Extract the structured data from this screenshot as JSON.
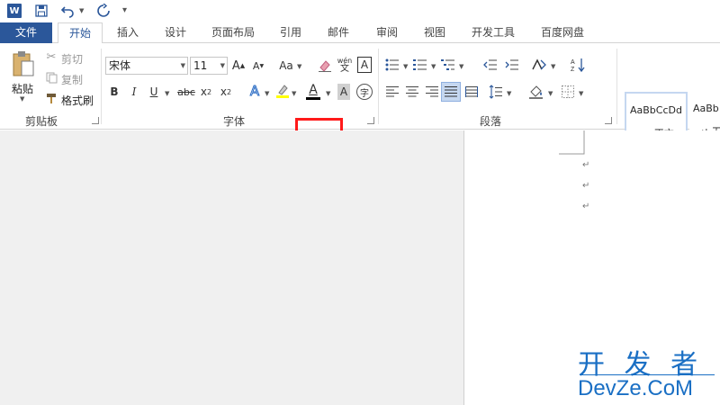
{
  "titlebar": {
    "app_icon": "word-icon",
    "save_icon": "save-icon",
    "undo_icon": "undo-icon",
    "redo_icon": "redo-icon",
    "qat_more": "▾"
  },
  "tabs": [
    {
      "label": "文件"
    },
    {
      "label": "开始"
    },
    {
      "label": "插入"
    },
    {
      "label": "设计"
    },
    {
      "label": "页面布局"
    },
    {
      "label": "引用"
    },
    {
      "label": "邮件"
    },
    {
      "label": "审阅"
    },
    {
      "label": "视图"
    },
    {
      "label": "开发工具"
    },
    {
      "label": "百度网盘"
    }
  ],
  "clipboard": {
    "group_label": "剪贴板",
    "paste_label": "粘贴",
    "cut_label": "剪切",
    "copy_label": "复制",
    "format_painter_label": "格式刷"
  },
  "font": {
    "group_label": "字体",
    "font_name": "宋体",
    "font_size": "11",
    "change_case": "Aa",
    "bold": "B",
    "italic": "I",
    "underline": "U",
    "strikethrough": "abc",
    "subscript_base": "x",
    "subscript": "2",
    "superscript_base": "x",
    "superscript": "2",
    "font_color_letter": "A",
    "phonetic_top": "wén",
    "phonetic_bottom": "文",
    "char_border": "A",
    "enclose": "字",
    "grow": "A",
    "shrink": "A",
    "text_effect": "A",
    "shading": "A"
  },
  "paragraph": {
    "group_label": "段落"
  },
  "styles": {
    "items": [
      {
        "preview": "AaBbCcDd",
        "name": "↵ 正文"
      },
      {
        "preview": "AaBb",
        "name": "↵ 无"
      }
    ]
  },
  "document": {
    "paragraph_mark": "↵"
  },
  "watermark": {
    "top": "开 发 者",
    "bottom": "DevZe.CoM"
  },
  "colors": {
    "file_tab": "#2b579a",
    "active_tab_text": "#2b579a",
    "highlight_box": "#ff1a1a",
    "watermark": "#1a6fc4"
  }
}
